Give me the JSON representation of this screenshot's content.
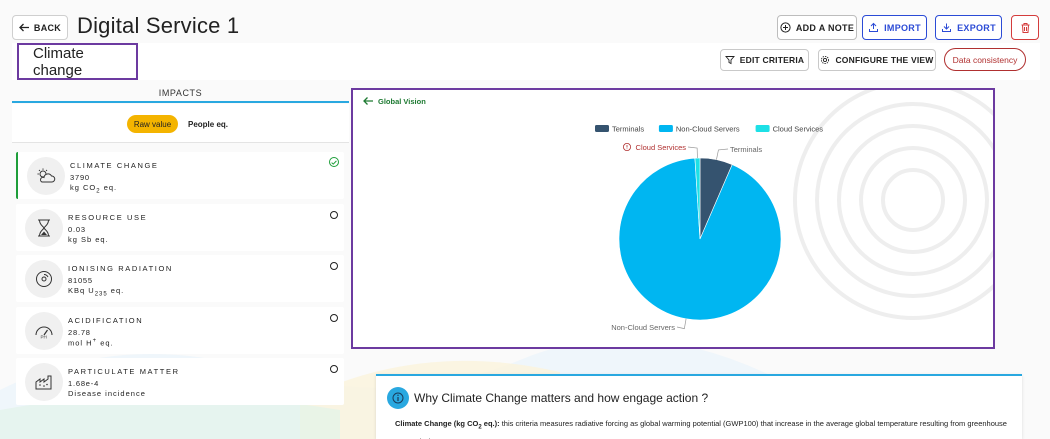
{
  "header": {
    "back_label": "BACK",
    "title": "Digital Service 1",
    "add_note_label": "ADD A NOTE",
    "import_label": "IMPORT",
    "export_label": "EXPORT"
  },
  "subheader": {
    "criteria_title": "Climate change",
    "edit_criteria_label": "EDIT CRITERIA",
    "configure_view_label": "CONFIGURE THE VIEW",
    "data_consistency_label": "Data consistency"
  },
  "impacts": {
    "tab_label": "IMPACTS",
    "toggle_raw": "Raw value",
    "toggle_people": "People eq.",
    "cards": [
      {
        "name": "CLIMATE CHANGE",
        "value": "3790",
        "unit_prefix": "kg CO",
        "unit_sub": "2",
        "unit_suffix": " eq.",
        "icon": "cloud-sun-icon",
        "selected": true
      },
      {
        "name": "RESOURCE USE",
        "value": "0.03",
        "unit_prefix": "kg Sb eq.",
        "unit_sub": "",
        "unit_suffix": "",
        "icon": "hourglass-icon",
        "selected": false
      },
      {
        "name": "IONISING RADIATION",
        "value": "81055",
        "unit_prefix": "KBq U",
        "unit_sub": "235",
        "unit_suffix": " eq.",
        "icon": "radiation-icon",
        "selected": false
      },
      {
        "name": "ACIDIFICATION",
        "value": "28.78",
        "unit_prefix": "mol H",
        "unit_sup": "+",
        "unit_suffix": " eq.",
        "icon": "ph-gauge-icon",
        "selected": false
      },
      {
        "name": "PARTICULATE MATTER",
        "value": "1.68e-4",
        "unit_prefix": "Disease incidence",
        "unit_sub": "",
        "unit_suffix": "",
        "icon": "factory-icon",
        "selected": false
      }
    ]
  },
  "chart_panel": {
    "back_label": "Global Vision"
  },
  "chart_data": {
    "type": "pie",
    "categories": [
      "Terminals",
      "Non-Cloud Servers",
      "Cloud Services"
    ],
    "values": [
      6.5,
      92.5,
      1.0
    ],
    "colors": [
      "#35536f",
      "#00b6f1",
      "#1de0e6"
    ],
    "legend_position": "top",
    "slice_labels": [
      "Terminals",
      "Non-Cloud Servers",
      "Cloud Services"
    ]
  },
  "info": {
    "title": "Why Climate Change matters and how engage action ?",
    "term_prefix": "Climate Change (kg CO",
    "term_sub": "2",
    "term_suffix": " eq.):",
    "description": " this criteria measures radiative forcing as global warming potential (GWP100) that increase in the average global temperature resulting from greenhouse gas emission."
  }
}
